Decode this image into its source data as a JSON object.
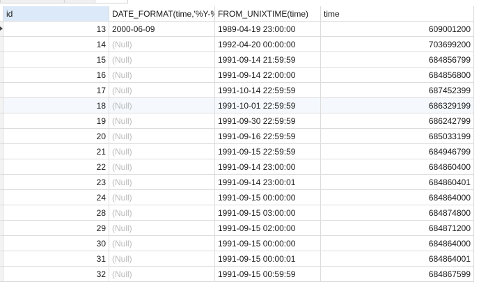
{
  "columns": [
    "id",
    "DATE_FORMAT(time,'%Y-%",
    "FROM_UNIXTIME(time)",
    "time"
  ],
  "rows": [
    {
      "id": "13",
      "date_format": "2000-06-09",
      "from_unixtime": "1989-04-19 23:00:00",
      "time": "609001200"
    },
    {
      "id": "14",
      "date_format": "(Null)",
      "from_unixtime": "1992-04-20 00:00:00",
      "time": "703699200"
    },
    {
      "id": "15",
      "date_format": "(Null)",
      "from_unixtime": "1991-09-14 21:59:59",
      "time": "684856799"
    },
    {
      "id": "16",
      "date_format": "(Null)",
      "from_unixtime": "1991-09-14 22:00:00",
      "time": "684856800"
    },
    {
      "id": "17",
      "date_format": "(Null)",
      "from_unixtime": "1991-10-14 22:59:59",
      "time": "687452399"
    },
    {
      "id": "18",
      "date_format": "(Null)",
      "from_unixtime": "1991-10-01 22:59:59",
      "time": "686329199"
    },
    {
      "id": "19",
      "date_format": "(Null)",
      "from_unixtime": "1991-09-30 22:59:59",
      "time": "686242799"
    },
    {
      "id": "20",
      "date_format": "(Null)",
      "from_unixtime": "1991-09-16 22:59:59",
      "time": "685033199"
    },
    {
      "id": "21",
      "date_format": "(Null)",
      "from_unixtime": "1991-09-15 22:59:59",
      "time": "684946799"
    },
    {
      "id": "22",
      "date_format": "(Null)",
      "from_unixtime": "1991-09-14 23:00:00",
      "time": "684860400"
    },
    {
      "id": "23",
      "date_format": "(Null)",
      "from_unixtime": "1991-09-14 23:00:01",
      "time": "684860401"
    },
    {
      "id": "24",
      "date_format": "(Null)",
      "from_unixtime": "1991-09-15 00:00:00",
      "time": "684864000"
    },
    {
      "id": "28",
      "date_format": "(Null)",
      "from_unixtime": "1991-09-15 03:00:00",
      "time": "684874800"
    },
    {
      "id": "29",
      "date_format": "(Null)",
      "from_unixtime": "1991-09-15 02:00:00",
      "time": "684871200"
    },
    {
      "id": "30",
      "date_format": "(Null)",
      "from_unixtime": "1991-09-15 00:00:00",
      "time": "684864000"
    },
    {
      "id": "31",
      "date_format": "(Null)",
      "from_unixtime": "1991-09-15 00:00:01",
      "time": "684864001"
    },
    {
      "id": "32",
      "date_format": "(Null)",
      "from_unixtime": "1991-09-15 00:59:59",
      "time": "684867599"
    }
  ]
}
